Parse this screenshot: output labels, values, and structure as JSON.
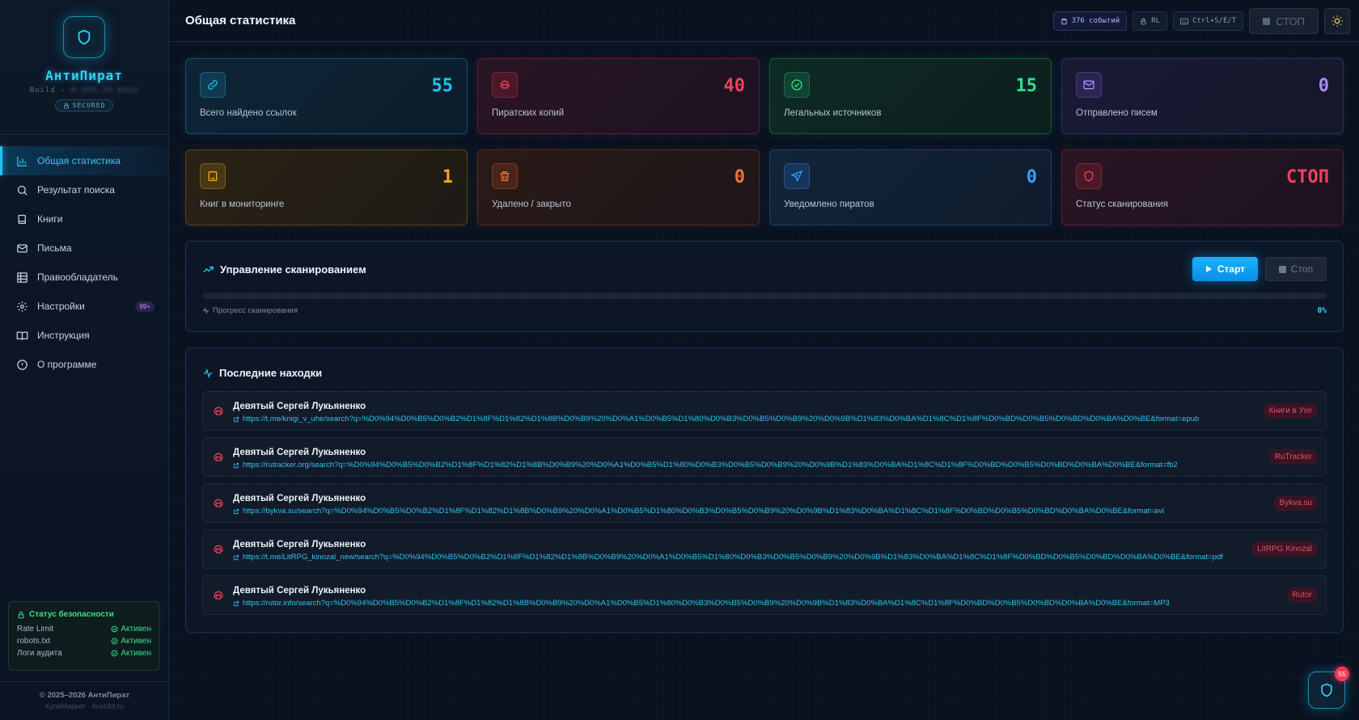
{
  "brand": {
    "name": "АнтиПират",
    "build_prefix": "Build -",
    "build_value": "0.295.25 beta",
    "secured": "SECURED"
  },
  "nav": [
    {
      "label": "Общая статистика",
      "icon": "bar-chart-icon",
      "active": true
    },
    {
      "label": "Результат поиска",
      "icon": "search-icon",
      "active": false
    },
    {
      "label": "Книги",
      "icon": "book-icon",
      "active": false
    },
    {
      "label": "Письма",
      "icon": "mail-icon",
      "active": false
    },
    {
      "label": "Правообладатель",
      "icon": "table-icon",
      "active": false
    },
    {
      "label": "Настройки",
      "icon": "gear-icon",
      "active": false,
      "badge": "99+"
    },
    {
      "label": "Инструкция",
      "icon": "open-book-icon",
      "active": false
    },
    {
      "label": "О программе",
      "icon": "info-icon",
      "active": false
    }
  ],
  "security": {
    "title": "Статус безопасности",
    "rows": [
      {
        "label": "Rate Limit",
        "status": "Активен"
      },
      {
        "label": "robots.txt",
        "status": "Активен"
      },
      {
        "label": "Логи аудита",
        "status": "Активен"
      }
    ]
  },
  "footer": {
    "copyright": "© 2025–2026 АнтиПират",
    "sub": "КупиМаркет · buycltd.ru"
  },
  "header": {
    "title": "Общая статистика",
    "events": "376 событий",
    "rl": "RL",
    "shortcut": "Ctrl+S/E/T",
    "stop": "СТОП"
  },
  "cards": [
    {
      "value": "55",
      "label": "Всего найдено ссылок",
      "icon": "link-icon",
      "color": "#1fc6ef"
    },
    {
      "value": "40",
      "label": "Пиратских копий",
      "icon": "skull-icon",
      "color": "#f0405e"
    },
    {
      "value": "15",
      "label": "Легальных источников",
      "icon": "check-circle-icon",
      "color": "#33e08a"
    },
    {
      "value": "0",
      "label": "Отправлено писем",
      "icon": "mail-icon",
      "color": "#a98bff"
    },
    {
      "value": "1",
      "label": "Книг в мониторинге",
      "icon": "book-icon",
      "color": "#f4a71d"
    },
    {
      "value": "0",
      "label": "Удалено / закрыто",
      "icon": "trash-icon",
      "color": "#f0743a"
    },
    {
      "value": "0",
      "label": "Уведомлено пиратов",
      "icon": "send-icon",
      "color": "#3b9ff5"
    },
    {
      "value": "СТОП",
      "label": "Статус сканирования",
      "icon": "shield-icon",
      "color": "#f0405e"
    }
  ],
  "scan": {
    "title": "Управление сканированием",
    "start": "Старт",
    "stop": "Стоп",
    "progress_label": "Прогресс сканирования",
    "progress_text": "0%",
    "progress_fraction": 0
  },
  "finds": {
    "title": "Последние находки",
    "items": [
      {
        "title": "Девятый Сергей Лукьяненко",
        "url": "https://t.me/knigi_v_uhe/search?q=%D0%94%D0%B5%D0%B2%D1%8F%D1%82%D1%8B%D0%B9%20%D0%A1%D0%B5%D1%80%D0%B3%D0%B5%D0%B9%20%D0%9B%D1%83%D0%BA%D1%8C%D1%8F%D0%BD%D0%B5%D0%BD%D0%BA%D0%BE&format=epub",
        "source": "Книги в Ухе"
      },
      {
        "title": "Девятый Сергей Лукьяненко",
        "url": "https://rutracker.org/search?q=%D0%94%D0%B5%D0%B2%D1%8F%D1%82%D1%8B%D0%B9%20%D0%A1%D0%B5%D1%80%D0%B3%D0%B5%D0%B9%20%D0%9B%D1%83%D0%BA%D1%8C%D1%8F%D0%BD%D0%B5%D0%BD%D0%BA%D0%BE&format=fb2",
        "source": "RuTracker"
      },
      {
        "title": "Девятый Сергей Лукьяненко",
        "url": "https://bykva.su/search?q=%D0%94%D0%B5%D0%B2%D1%8F%D1%82%D1%8B%D0%B9%20%D0%A1%D0%B5%D1%80%D0%B3%D0%B5%D0%B9%20%D0%9B%D1%83%D0%BA%D1%8C%D1%8F%D0%BD%D0%B5%D0%BD%D0%BA%D0%BE&format=avi",
        "source": "Bykva.su"
      },
      {
        "title": "Девятый Сергей Лукьяненко",
        "url": "https://t.me/LitRPG_kinozal_new/search?q=%D0%94%D0%B5%D0%B2%D1%8F%D1%82%D1%8B%D0%B9%20%D0%A1%D0%B5%D1%80%D0%B3%D0%B5%D0%B9%20%D0%9B%D1%83%D0%BA%D1%8C%D1%8F%D0%BD%D0%B5%D0%BD%D0%BA%D0%BE&format=pdf",
        "source": "LitRPG Kinozal"
      },
      {
        "title": "Девятый Сергей Лукьяненко",
        "url": "https://rutor.info/search?q=%D0%94%D0%B5%D0%B2%D1%8F%D1%82%D1%8B%D0%B9%20%D0%A1%D0%B5%D1%80%D0%B3%D0%B5%D0%B9%20%D0%9B%D1%83%D0%BA%D1%8C%D1%8F%D0%BD%D0%B5%D0%BD%D0%BA%D0%BE&format=MP3",
        "source": "Rutor"
      }
    ]
  },
  "fab": {
    "badge": "55"
  }
}
